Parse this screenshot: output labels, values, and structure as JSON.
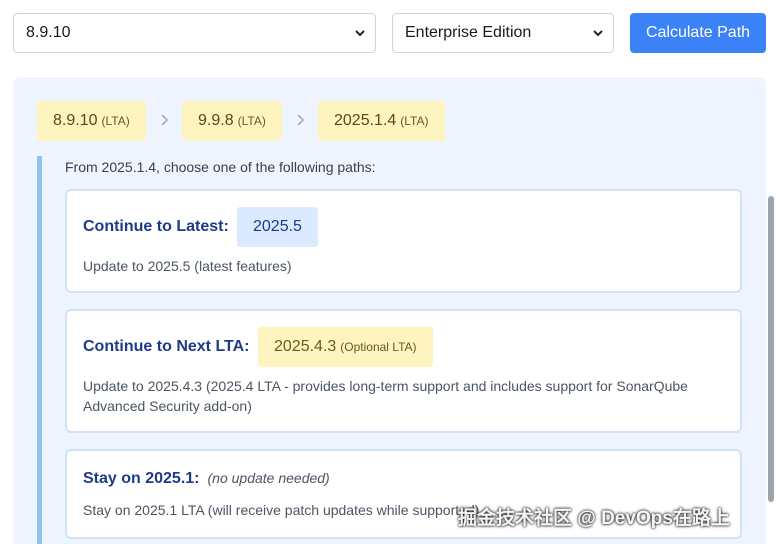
{
  "controls": {
    "version_value": "8.9.10",
    "edition_value": "Enterprise Edition",
    "calculate_label": "Calculate Path"
  },
  "path": [
    {
      "version": "8.9.10",
      "tag": "(LTA)"
    },
    {
      "version": "9.9.8",
      "tag": "(LTA)"
    },
    {
      "version": "2025.1.4",
      "tag": "(LTA)"
    }
  ],
  "options": {
    "intro": "From 2025.1.4, choose one of the following paths:",
    "latest": {
      "title": "Continue to Latest:",
      "version": "2025.5",
      "desc": "Update to 2025.5 (latest features)"
    },
    "next_lta": {
      "title": "Continue to Next LTA:",
      "version": "2025.4.3",
      "tag": "(Optional LTA)",
      "desc": "Update to 2025.4.3 (2025.4 LTA - provides long-term support and includes support for SonarQube Advanced Security add-on)"
    },
    "stay": {
      "title": "Stay on 2025.1:",
      "note": "(no update needed)",
      "desc": "Stay on 2025.1 LTA (will receive patch updates while supported)"
    }
  },
  "watermark": "掘金技术社区 @ DevOps在路上",
  "icons": {
    "dropdown": "chevron-down-icon",
    "separator": "chevron-right-icon"
  }
}
